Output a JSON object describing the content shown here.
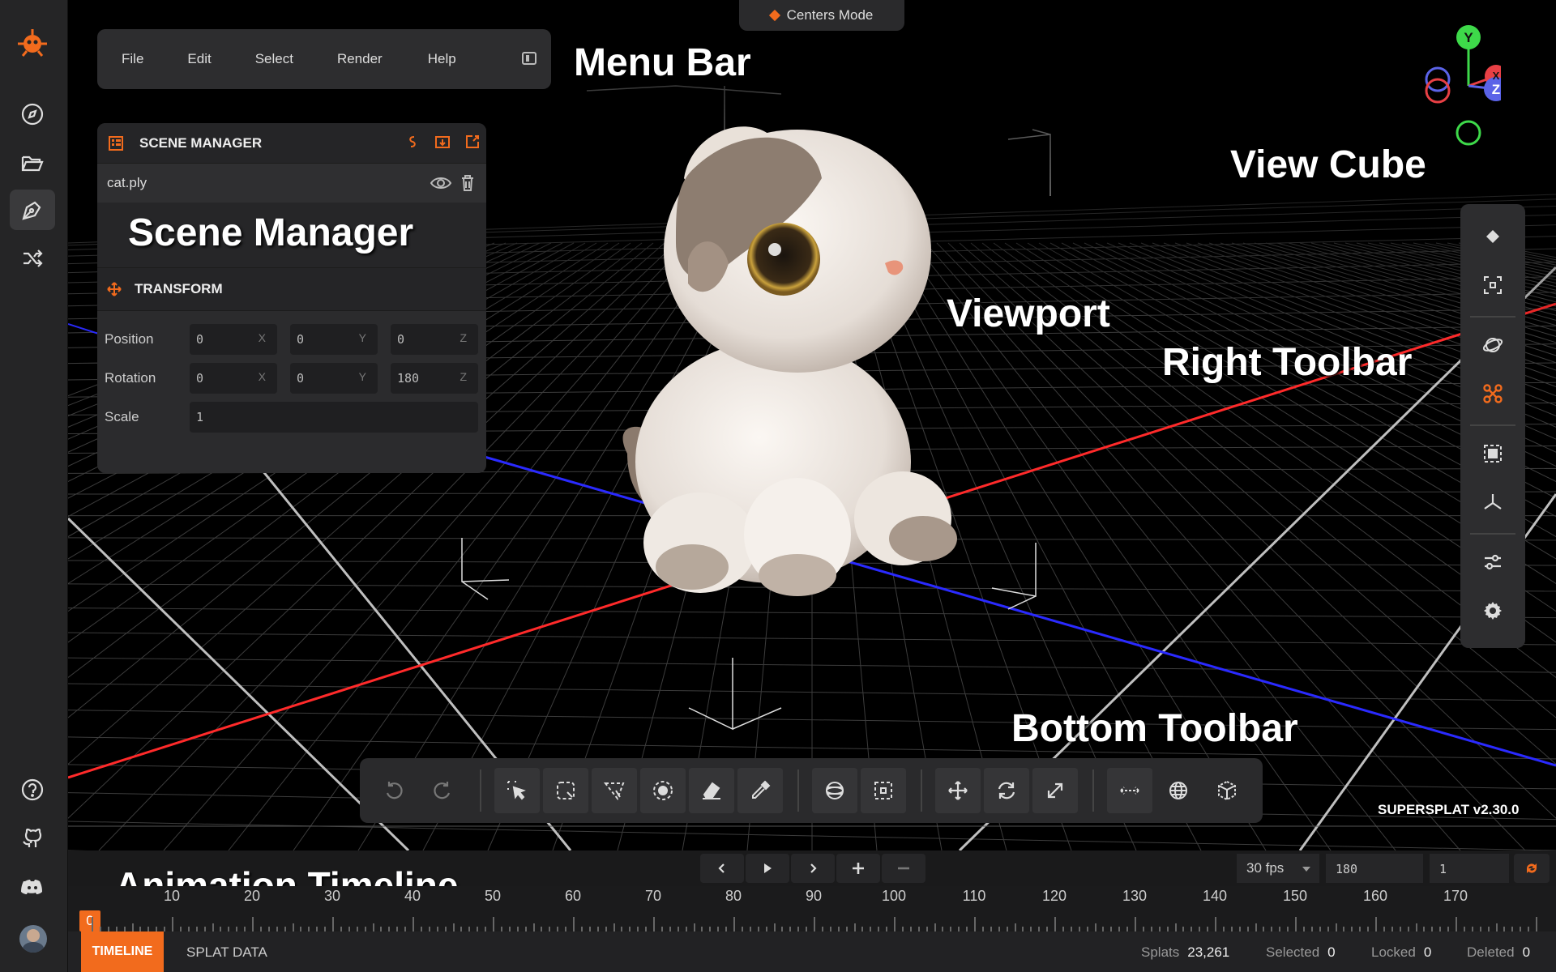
{
  "mode_pill": {
    "label": "Centers Mode"
  },
  "menu": {
    "items": [
      "File",
      "Edit",
      "Select",
      "Render",
      "Help"
    ]
  },
  "scene_manager": {
    "title": "SCENE MANAGER",
    "file": "cat.ply",
    "transform_title": "TRANSFORM",
    "position": {
      "label": "Position",
      "x": "0",
      "y": "0",
      "z": "0"
    },
    "rotation": {
      "label": "Rotation",
      "x": "0",
      "y": "0",
      "z": "180"
    },
    "scale": {
      "label": "Scale",
      "value": "1"
    },
    "axis_labels": {
      "x": "X",
      "y": "Y",
      "z": "Z"
    }
  },
  "view_cube": {
    "y": "Y",
    "x": "X",
    "z": "Z",
    "colors": {
      "x": "#e84045",
      "y": "#3ed94a",
      "z": "#5b63e8"
    }
  },
  "version": "SUPERSPLAT v2.30.0",
  "annotations": {
    "menu_bar": "Menu Bar",
    "view_cube": "View Cube",
    "scene_manager": "Scene Manager",
    "viewport": "Viewport",
    "right_toolbar": "Right Toolbar",
    "bottom_toolbar": "Bottom Toolbar",
    "animation_timeline": "Animation Timeline"
  },
  "timeline": {
    "fps": "30 fps",
    "frames": "180",
    "speed": "1",
    "current_frame": "0",
    "ticks": [
      "10",
      "20",
      "30",
      "40",
      "50",
      "60",
      "70",
      "80",
      "90",
      "100",
      "110",
      "120",
      "130",
      "140",
      "150",
      "160",
      "170"
    ]
  },
  "status": {
    "tab_timeline": "TIMELINE",
    "tab_splat": "SPLAT DATA",
    "splats_label": "Splats",
    "splats_value": "23,261",
    "selected_label": "Selected",
    "selected_value": "0",
    "locked_label": "Locked",
    "locked_value": "0",
    "deleted_label": "Deleted",
    "deleted_value": "0"
  },
  "colors": {
    "accent": "#f26b1d",
    "panel": "#2d2d2f",
    "x_axis": "#ff2a2a",
    "z_axis": "#2a2aff"
  },
  "icons": {
    "rail": [
      "logo-icon",
      "compass-icon",
      "folder-open-icon",
      "pen-tool-icon",
      "shuffle-icon",
      "help-circle-icon",
      "github-icon",
      "discord-icon",
      "avatar"
    ],
    "right_toolbar": [
      "diamond-icon",
      "focus-frame-icon",
      "orbit-icon",
      "fly-icon",
      "frame-selection-icon",
      "axes-icon",
      "sliders-icon",
      "gear-icon"
    ],
    "bottom_toolbar": [
      "undo-icon",
      "redo-icon",
      "picker-select-icon",
      "lasso-select-icon",
      "polygon-select-icon",
      "brush-select-icon",
      "eraser-icon",
      "eyedropper-icon",
      "sphere-select-icon",
      "box-select-icon",
      "move-icon",
      "rotate-icon",
      "scale-icon",
      "measure-icon",
      "globe-icon",
      "cube-icon"
    ]
  }
}
